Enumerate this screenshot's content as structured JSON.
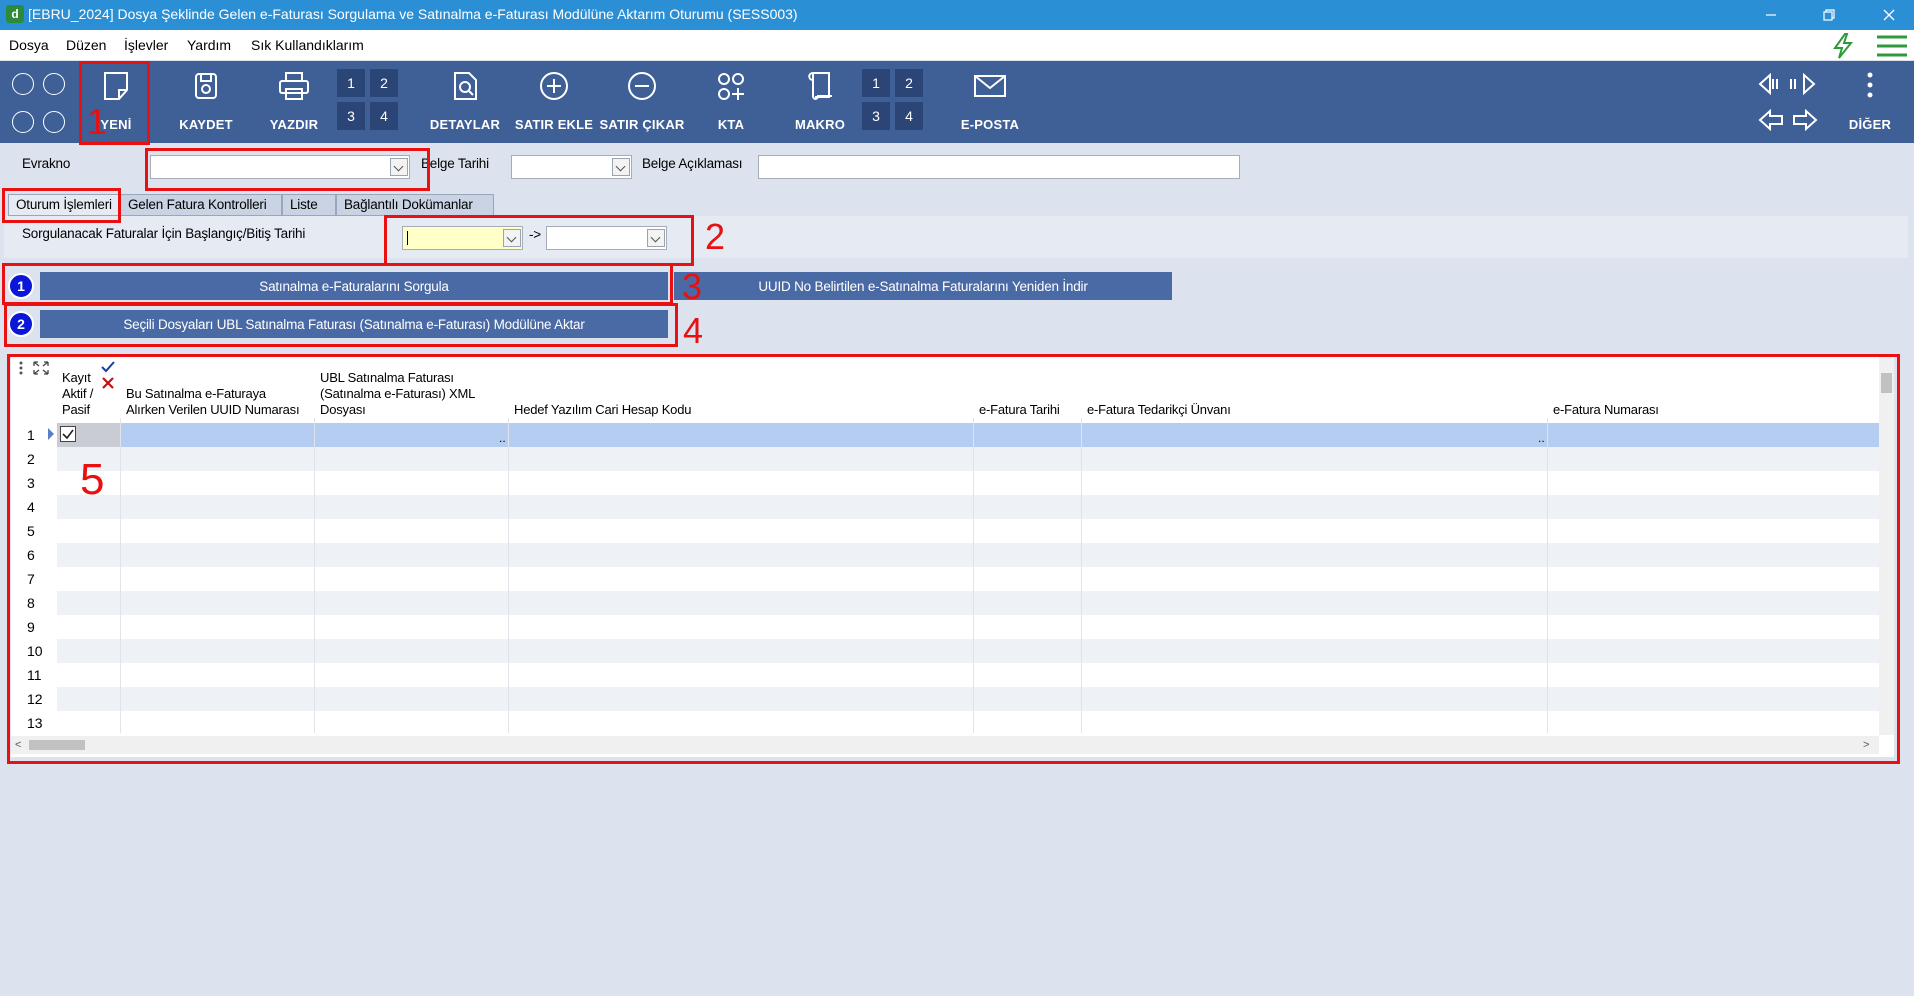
{
  "window": {
    "title": "[EBRU_2024] Dosya Şeklinde Gelen e-Faturası Sorgulama ve Satınalma e-Faturası Modülüne Aktarım Oturumu (SESS003)",
    "app_icon_letter": "d"
  },
  "menu": [
    "Dosya",
    "Düzen",
    "İşlevler",
    "Yardım",
    "Sık Kullandıklarım"
  ],
  "toolbar": {
    "new": "YENİ",
    "save": "KAYDET",
    "print": "YAZDIR",
    "details": "DETAYLAR",
    "add_row": "SATIR EKLE",
    "remove_row": "SATIR ÇIKAR",
    "kta": "KTA",
    "macro": "MAKRO",
    "email": "E-POSTA",
    "other": "DİĞER",
    "nums": [
      "1",
      "2",
      "3",
      "4"
    ]
  },
  "form": {
    "evrakno_label": "Evrakno",
    "evrakno_value": "",
    "belge_tarihi_label": "Belge Tarihi",
    "belge_tarihi_value": "",
    "belge_aciklamasi_label": "Belge Açıklaması",
    "belge_aciklamasi_value": ""
  },
  "tabs": [
    "Oturum İşlemleri",
    "Gelen Fatura Kontrolleri",
    "Liste",
    "Bağlantılı Dokümanlar"
  ],
  "date_range": {
    "label": "Sorgulanacak Faturalar İçin Başlangıç/Bitiş Tarihi",
    "start": "",
    "end": "",
    "sep": "->"
  },
  "buttons": {
    "query": "Satınalma e-Faturalarını Sorgula",
    "redownload": "UUID No Belirtilen e-Satınalma Faturalarını Yeniden İndir",
    "transfer": "Seçili Dosyaları UBL Satınalma Faturası (Satınalma e-Faturası) Modülüne Aktar",
    "step1": "1",
    "step2": "2"
  },
  "grid": {
    "columns": [
      [
        "Kayıt",
        "Aktif /",
        "Pasif"
      ],
      [
        "Bu Satınalma e-Faturaya",
        "Alırken Verilen UUID Numarası"
      ],
      [
        "UBL Satınalma Faturası",
        "(Satınalma e-Faturası) XML",
        "Dosyası"
      ],
      [
        "Hedef Yazılım Cari Hesap Kodu"
      ],
      [
        "e-Fatura Tarihi"
      ],
      [
        "e-Fatura Tedarikçi Ünvanı"
      ],
      [
        "e-Fatura Numarası"
      ]
    ],
    "rows": [
      "1",
      "2",
      "3",
      "4",
      "5",
      "6",
      "7",
      "8",
      "9",
      "10",
      "11",
      "12",
      "13"
    ],
    "ellipsis": ".."
  },
  "annotations": [
    "1",
    "2",
    "3",
    "4",
    "5"
  ],
  "colors": {
    "titlebar": "#2b8fd6",
    "toolbar": "#3f5f97",
    "button": "#4a6aa5",
    "annotation": "#e81010",
    "selected_row": "#b5cdf0"
  }
}
